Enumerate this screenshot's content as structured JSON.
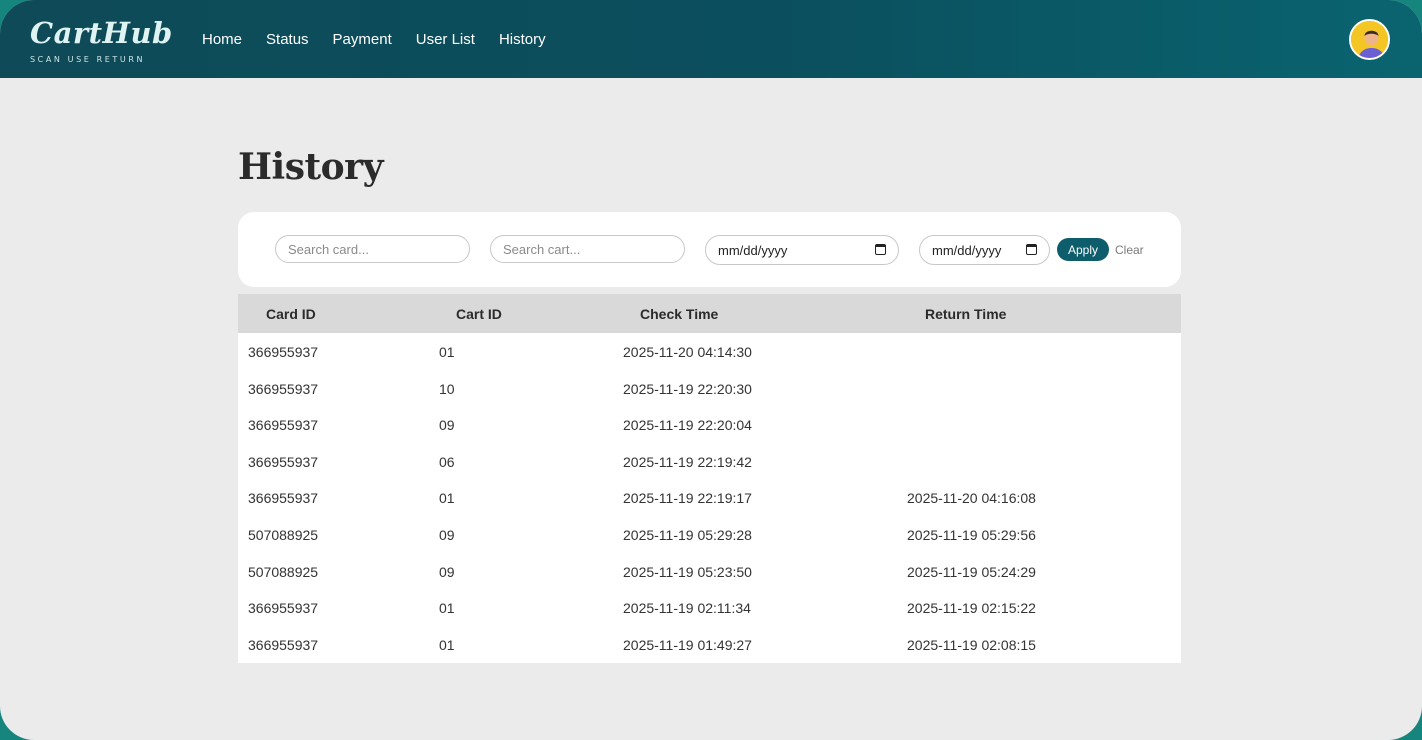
{
  "brand": {
    "logo": "CartHub",
    "tagline": "SCAN USE RETURN"
  },
  "nav": {
    "links": [
      "Home",
      "Status",
      "Payment",
      "User List",
      "History"
    ]
  },
  "page": {
    "title": "History"
  },
  "filters": {
    "card_placeholder": "Search card...",
    "cart_placeholder": "Search cart...",
    "date_from": "mm/dd/yyyy",
    "date_to": "mm/dd/yyyy",
    "apply_label": "Apply",
    "clear_label": "Clear"
  },
  "table": {
    "columns": [
      "Card ID",
      "Cart ID",
      "Check Time",
      "Return Time"
    ],
    "rows": [
      [
        "366955937",
        "01",
        "2025-11-20 04:14:30",
        ""
      ],
      [
        "366955937",
        "10",
        "2025-11-19 22:20:30",
        ""
      ],
      [
        "366955937",
        "09",
        "2025-11-19 22:20:04",
        ""
      ],
      [
        "366955937",
        "06",
        "2025-11-19 22:19:42",
        ""
      ],
      [
        "366955937",
        "01",
        "2025-11-19 22:19:17",
        "2025-11-20 04:16:08"
      ],
      [
        "507088925",
        "09",
        "2025-11-19 05:29:28",
        "2025-11-19 05:29:56"
      ],
      [
        "507088925",
        "09",
        "2025-11-19 05:23:50",
        "2025-11-19 05:24:29"
      ],
      [
        "366955937",
        "01",
        "2025-11-19 02:11:34",
        "2025-11-19 02:15:22"
      ],
      [
        "366955937",
        "01",
        "2025-11-19 01:49:27",
        "2025-11-19 02:08:15"
      ]
    ]
  },
  "colors": {
    "nav_bg": "#0e4a57",
    "accent": "#0e5d6c",
    "page_bg": "#ebebeb",
    "table_header_bg": "#d9d9d9"
  }
}
